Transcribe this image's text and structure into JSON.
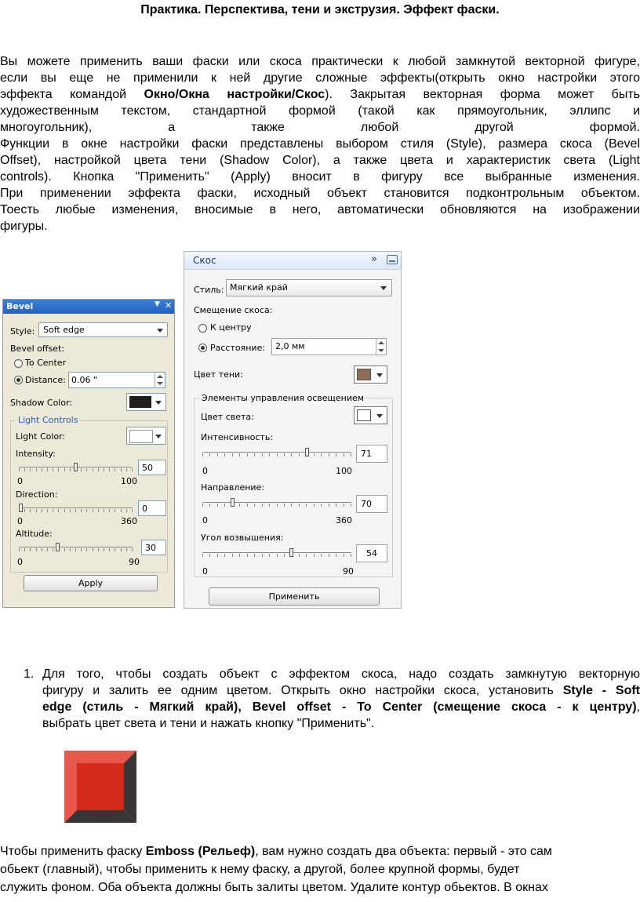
{
  "title": "Практика. Перспектива, тени и экструзия. Эффект фаски.",
  "intro_lines": [
    "Вы можете применить ваши фаски или скоса практически к любой замкнутой векторной фигуре,",
    "если вы еще не применили к ней другие сложные эффекты(открыть окно настройки этого",
    "эффекта командой ",
    "художественным текстом, стандартной формой (такой как прямоугольник, эллипс и",
    "многоугольник), а также любой другой формой.",
    "Функции в окне настройки фаски представлены выбором стиля (Style), размера скоса (Bevel",
    "Offset), настройкой цвета тени (Shadow Color), а также цвета и характеристик света (Light",
    "controls). Кнопка \"Применить\" (Apply) вносит в фигуру все выбранные изменения.",
    "При применении эффекта фаски, исходный объект становится подконтрольным объектом.",
    "Тоесть любые изменения, вносимые в него, автоматически обновляются на изображении",
    "фигуры."
  ],
  "intro_bold": "Окно/Окна настройки/Скос",
  "intro_line3_tail": "). Закрытая векторная форма может быть",
  "en_dialog": {
    "title": "Bevel",
    "style_label": "Style:",
    "style_value": "Soft edge",
    "bevel_offset": "Bevel offset:",
    "to_center": "To Center",
    "distance": "Distance:",
    "distance_value": "0.06 \"",
    "shadow_color": "Shadow Color:",
    "light_controls": "Light Controls",
    "light_color": "Light Color:",
    "intensity": "Intensity:",
    "intensity_value": "50",
    "intensity_min": "0",
    "intensity_max": "100",
    "direction": "Direction:",
    "direction_value": "0",
    "direction_min": "0",
    "direction_max": "360",
    "altitude": "Altitude:",
    "altitude_value": "30",
    "altitude_min": "0",
    "altitude_max": "90",
    "apply": "Apply",
    "shadow_swatch": "#1f1f1f",
    "light_swatch": "#ffffff"
  },
  "ru_dialog": {
    "title": "Скос",
    "style_label": "Стиль:",
    "style_value": "Мягкий край",
    "bevel_offset": "Смещение скоса:",
    "to_center": "К центру",
    "distance": "Расстояние:",
    "distance_value": "2,0 мм",
    "shadow_color": "Цвет тени:",
    "light_controls": "Элементы управления освещением",
    "light_color": "Цвет света:",
    "intensity": "Интенсивность:",
    "intensity_value": "71",
    "intensity_min": "0",
    "intensity_max": "100",
    "direction": "Направление:",
    "direction_value": "70",
    "direction_min": "0",
    "direction_max": "360",
    "altitude": "Угол возвышения:",
    "altitude_value": "54",
    "altitude_min": "0",
    "altitude_max": "90",
    "apply": "Применить",
    "shadow_swatch": "#8b6c55",
    "light_swatch": "#ffffff"
  },
  "step1": {
    "number": "1.",
    "l1": "Для того, чтобы создать объект с эффектом скоса, надо создать замкнутую векторную",
    "l2a": "фигуру и залить ее одним цветом. Открыть окно настройки скоса, установить ",
    "l2b": "Style - Soft",
    "l3b": "edge (стиль - Мягкий край), Bevel offset - To Center (смещение скоса - к центру)",
    "l3c": ",",
    "l4": "выбрать цвет света и тени и нажать кнопку \"Применить\"."
  },
  "example_colors": {
    "face": "#d32a1c",
    "dark": "#3a3535",
    "light": "#e8584a"
  },
  "bottom": {
    "l1a": "Чтобы применить фаску ",
    "l1b": "Emboss (Рельеф)",
    "l1c": ", вам нужно создать два объекта: первый - это сам",
    "l2": "обьект (главный), чтобы применить к нему фаску, а другой, более крупной формы, будет",
    "l3": "служить фоном. Оба объекта должны быть залиты цветом. Удалите контур обьектов. В окнах"
  }
}
